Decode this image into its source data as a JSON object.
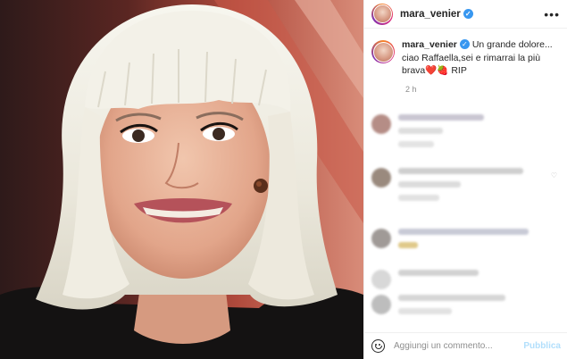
{
  "post": {
    "username": "mara_venier",
    "verified_icon": "verified-badge-icon",
    "more_icon": "ellipsis-icon",
    "caption_username": "mara_venier",
    "caption_text": "Un grande dolore... ciao Raffaella,sei e rimarrai la più brava",
    "caption_emojis": [
      "❤️",
      "🍓"
    ],
    "caption_suffix": "RIP",
    "timestamp": "2 h"
  },
  "comments": {
    "blurred": true,
    "count_visible": 6
  },
  "footer": {
    "emoji_icon": "emoji-smile-icon",
    "placeholder": "Aggiungi un commento...",
    "publish_label": "Pubblica"
  },
  "colors": {
    "verified": "#3897f0",
    "publish_disabled": "#b2dffc",
    "muted_text": "#8e8e8e"
  }
}
